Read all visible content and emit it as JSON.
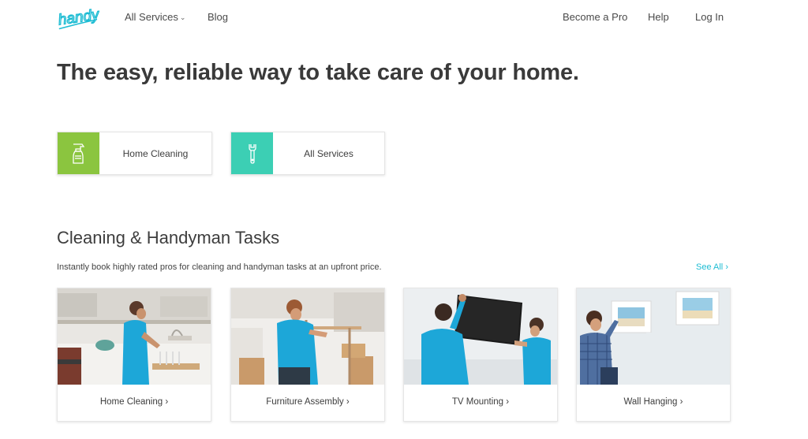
{
  "header": {
    "logo_text": "handy",
    "nav_left": [
      {
        "label": "All Services",
        "chevron": "chevron-down-icon"
      },
      {
        "label": "Blog"
      }
    ],
    "nav_right": [
      {
        "label": "Become a Pro"
      },
      {
        "label": "Help"
      },
      {
        "label": "Log In"
      }
    ]
  },
  "hero": {
    "title": "The easy, reliable way to take care of your home."
  },
  "services": [
    {
      "label": "Home Cleaning",
      "icon": "spray-bottle-icon",
      "color": "#8bc53f"
    },
    {
      "label": "All Services",
      "icon": "wrench-icon",
      "color": "#3ccfb4"
    }
  ],
  "tasks_section": {
    "title": "Cleaning & Handyman Tasks",
    "subtitle": "Instantly book highly rated pros for cleaning and handyman tasks at an upfront price.",
    "see_all": "See All",
    "cards": [
      {
        "label": "Home Cleaning",
        "image": "home-cleaning-photo"
      },
      {
        "label": "Furniture Assembly",
        "image": "furniture-assembly-photo"
      },
      {
        "label": "TV Mounting",
        "image": "tv-mounting-photo"
      },
      {
        "label": "Wall Hanging",
        "image": "wall-hanging-photo"
      }
    ]
  },
  "colors": {
    "brand": "#1dbcd3",
    "text": "#3d3d3d",
    "cleaning_green": "#8bc53f",
    "services_teal": "#3ccfb4"
  }
}
